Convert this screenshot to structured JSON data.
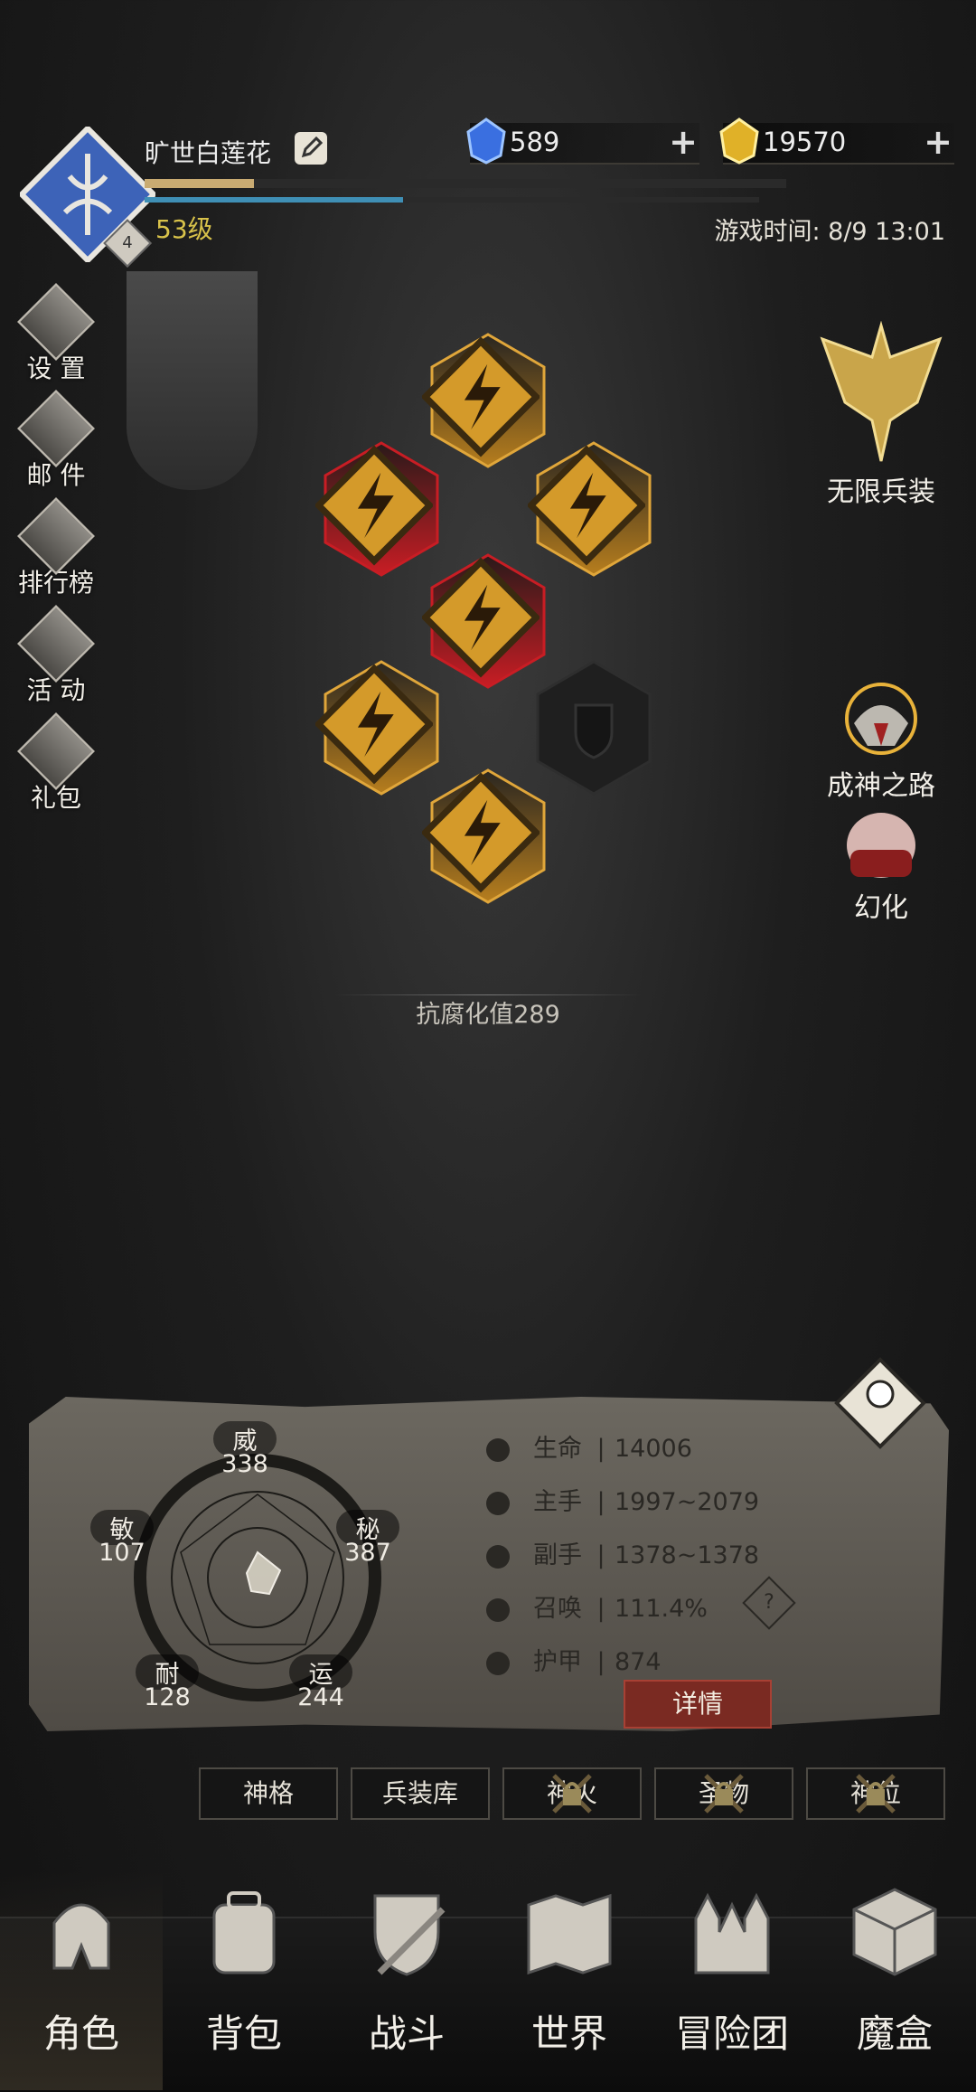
{
  "player": {
    "name": "旷世白莲花",
    "level_text": "53级",
    "rank_badge": "4",
    "xp_progress": 0.17,
    "mp_progress": 0.42
  },
  "currencies": {
    "gems": "589",
    "gold": "19570"
  },
  "game_time": "游戏时间: 8/9 13:01",
  "side_menu": [
    {
      "label": "设 置",
      "icon": "gear-icon"
    },
    {
      "label": "邮 件",
      "icon": "mail-icon"
    },
    {
      "label": "排行榜",
      "icon": "leaderboard-icon"
    },
    {
      "label": "活 动",
      "icon": "event-icon"
    },
    {
      "label": "礼包",
      "icon": "gift-icon"
    }
  ],
  "right_menu": {
    "infinite_gear": "无限兵装",
    "god_path": "成神之路",
    "transform": "幻化"
  },
  "equipment_slots": [
    {
      "slot": "hat",
      "rarity": "gold"
    },
    {
      "slot": "shoulder",
      "rarity": "red"
    },
    {
      "slot": "gloves",
      "rarity": "gold"
    },
    {
      "slot": "armor",
      "rarity": "red"
    },
    {
      "slot": "weapon",
      "rarity": "gold"
    },
    {
      "slot": "offhand",
      "rarity": "empty"
    },
    {
      "slot": "boots",
      "rarity": "gold"
    }
  ],
  "corrosion_resistance": "抗腐化值289",
  "attributes": {
    "wei": {
      "label": "威",
      "value": "338"
    },
    "mi": {
      "label": "秘",
      "value": "387"
    },
    "yun": {
      "label": "运",
      "value": "244"
    },
    "nai": {
      "label": "耐",
      "value": "128"
    },
    "min": {
      "label": "敏",
      "value": "107"
    }
  },
  "stats": [
    {
      "name": "生命",
      "value": "14006",
      "icon": "heart-icon"
    },
    {
      "name": "主手",
      "value": "1997~2079",
      "icon": "sword-icon"
    },
    {
      "name": "副手",
      "value": "1378~1378",
      "icon": "dagger-icon"
    },
    {
      "name": "召唤",
      "value": "111.4%",
      "icon": "summon-icon"
    },
    {
      "name": "护甲",
      "value": "874",
      "icon": "armor-icon"
    }
  ],
  "details_button": "详情",
  "tabs": [
    {
      "label": "神格",
      "locked": false
    },
    {
      "label": "兵装库",
      "locked": false
    },
    {
      "label": "神火",
      "locked": true
    },
    {
      "label": "圣物",
      "locked": true
    },
    {
      "label": "神位",
      "locked": true
    }
  ],
  "bottom_nav": [
    {
      "label": "角色",
      "icon": "helmet-icon",
      "active": true
    },
    {
      "label": "背包",
      "icon": "backpack-icon",
      "active": false
    },
    {
      "label": "战斗",
      "icon": "shield-sword-icon",
      "active": false
    },
    {
      "label": "世界",
      "icon": "map-icon",
      "active": false
    },
    {
      "label": "冒险团",
      "icon": "castle-icon",
      "active": false
    },
    {
      "label": "魔盒",
      "icon": "cube-icon",
      "active": false
    }
  ],
  "colors": {
    "gold_rarity": "#e0a63a",
    "red_rarity": "#c81d24",
    "level_text": "#d8c24a",
    "details_button": "#7a2a22"
  }
}
